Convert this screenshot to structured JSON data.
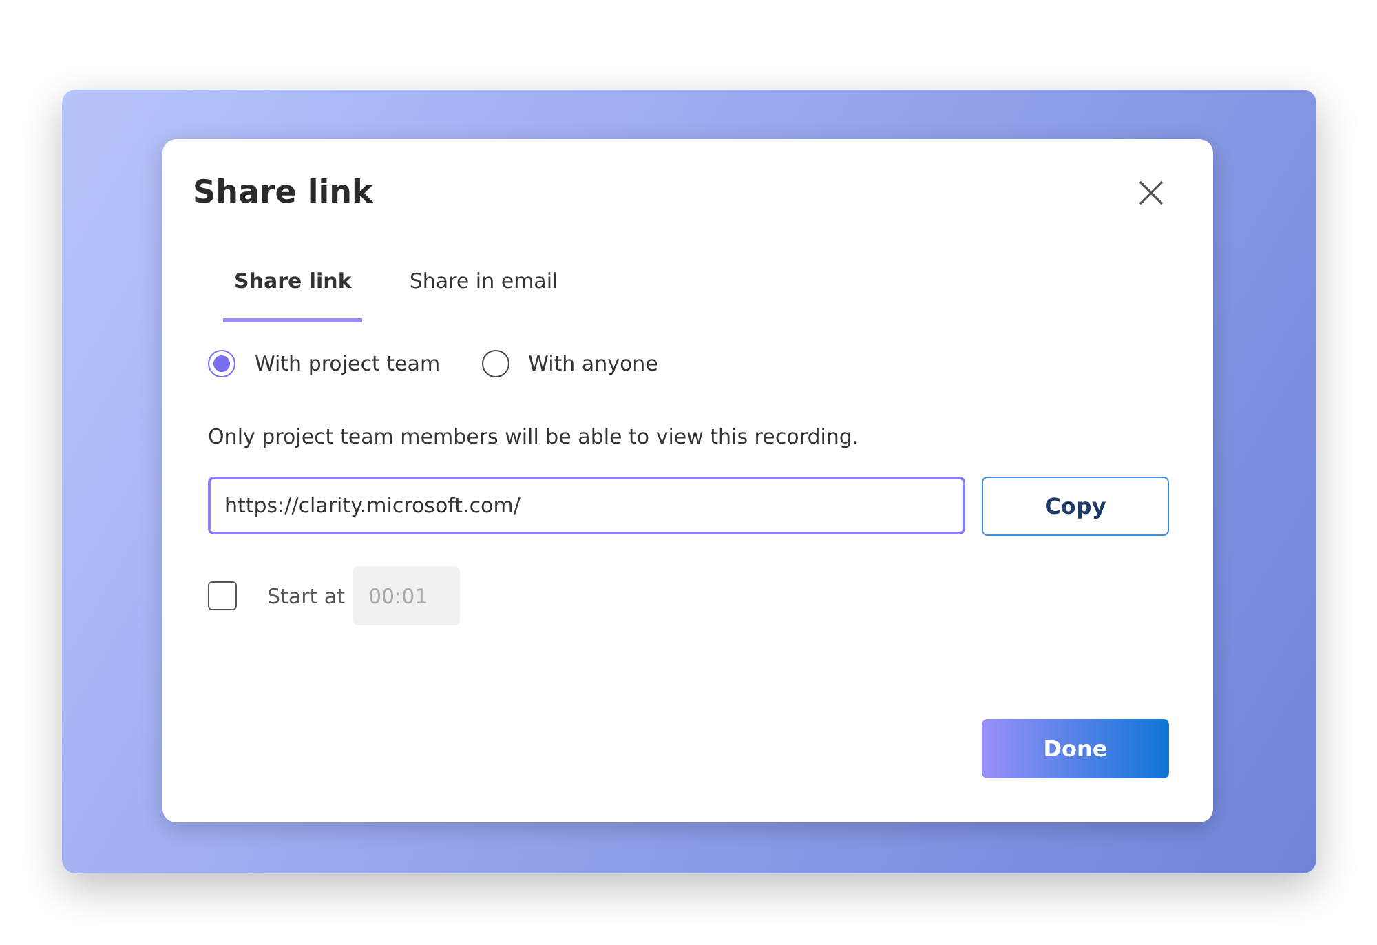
{
  "dialog": {
    "title": "Share link"
  },
  "tabs": [
    {
      "label": "Share link",
      "selected": true
    },
    {
      "label": "Share in email",
      "selected": false
    }
  ],
  "audience": [
    {
      "label": "With project team",
      "selected": true
    },
    {
      "label": "With anyone",
      "selected": false
    }
  ],
  "description": "Only project team members will be able to view this recording.",
  "link_field": {
    "value": "https://clarity.microsoft.com/"
  },
  "copy_button": "Copy",
  "start_at": {
    "label": "Start at",
    "checked": false,
    "value": "00:01",
    "disabled": true
  },
  "done_button": "Done"
}
